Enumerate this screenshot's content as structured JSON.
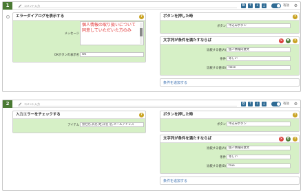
{
  "blocks": [
    {
      "number": "1",
      "comment_placeholder": "コメント入力",
      "toggle_label": "有効",
      "left_card": {
        "title": "エラーダイアログを表示する",
        "fields": [
          {
            "label": "メッセージ",
            "value": "個人情報の取り扱いについて\n同意していただいた方のみ"
          },
          {
            "label": "OKボタンの表示名",
            "value": "OK"
          }
        ]
      },
      "trigger_card": {
        "title": "ボタンを押した時",
        "fields": [
          {
            "label": "ボタン",
            "value": "申込みボタン"
          }
        ]
      },
      "condition_card": {
        "title": "文字列が条件を満たすならば",
        "fields": [
          {
            "label": "比較する値(A)",
            "value": "個人情報同意文"
          },
          {
            "label": "条件",
            "value": "等しい"
          },
          {
            "label": "比較する値(B)",
            "value": "false"
          }
        ]
      },
      "add_condition": "条件を追加する"
    },
    {
      "number": "2",
      "comment_placeholder": "コメント入力",
      "toggle_label": "有効",
      "left_card": {
        "title": "入力エラーをチェックする",
        "fields": [
          {
            "label": "アイテム",
            "value": "会社名,氏名,姓,氏名,名,メールアドレス"
          }
        ]
      },
      "trigger_card": {
        "title": "ボタンを押した時",
        "fields": [
          {
            "label": "ボタン",
            "value": "申込みボタン"
          }
        ]
      },
      "condition_card": {
        "title": "文字列が条件を満たすならば",
        "fields": [
          {
            "label": "比較する値(A)",
            "value": "個人情報同意文"
          },
          {
            "label": "条件",
            "value": "等しい"
          },
          {
            "label": "比較する値(B)",
            "value": "true"
          }
        ]
      },
      "add_condition": "条件を追加する"
    }
  ],
  "colors": {
    "rownum_bg": "#4a7a33",
    "control_blue": "#2f6b94",
    "card_body_green": "#d6f0c6",
    "help_yellow": "#c9a322",
    "delete_red": "#d9403c",
    "message_text_red": "#e03030",
    "link_blue": "#3a6fb0"
  },
  "icons": {
    "comment": "pencil-icon",
    "controls": [
      "copy-icon",
      "move-up-icon",
      "move-down-icon",
      "download-icon"
    ],
    "settings": "gear-icon",
    "help": "help-icon",
    "delete": "delete-icon",
    "duplicate": "duplicate-icon"
  }
}
